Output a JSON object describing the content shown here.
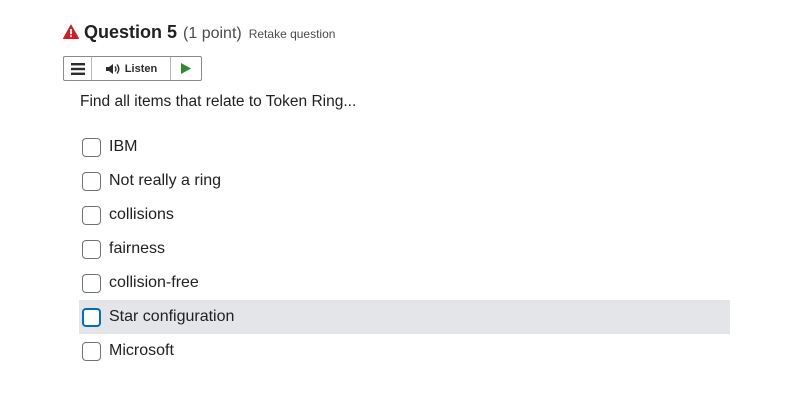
{
  "question": {
    "title": "Question 5",
    "points": "(1 point)",
    "retake_link": "Retake question",
    "prompt": "Find all items that relate to Token Ring..."
  },
  "listen_toolbar": {
    "menu_icon": "hamburger-menu-icon",
    "speaker_icon": "speaker-icon",
    "listen_label": "Listen",
    "play_icon": "play-icon"
  },
  "options": [
    {
      "label": "IBM",
      "checked": false
    },
    {
      "label": "Not really a ring",
      "checked": false
    },
    {
      "label": "collisions",
      "checked": false
    },
    {
      "label": "fairness",
      "checked": false
    },
    {
      "label": "collision-free",
      "checked": false
    },
    {
      "label": "Star configuration",
      "checked": false,
      "hovered": true
    },
    {
      "label": "Microsoft",
      "checked": false
    }
  ],
  "colors": {
    "warning": "#cd2026",
    "play": "#2e8b2e",
    "focus_border": "#006fbf",
    "hover_bg": "#e3e5e8"
  }
}
